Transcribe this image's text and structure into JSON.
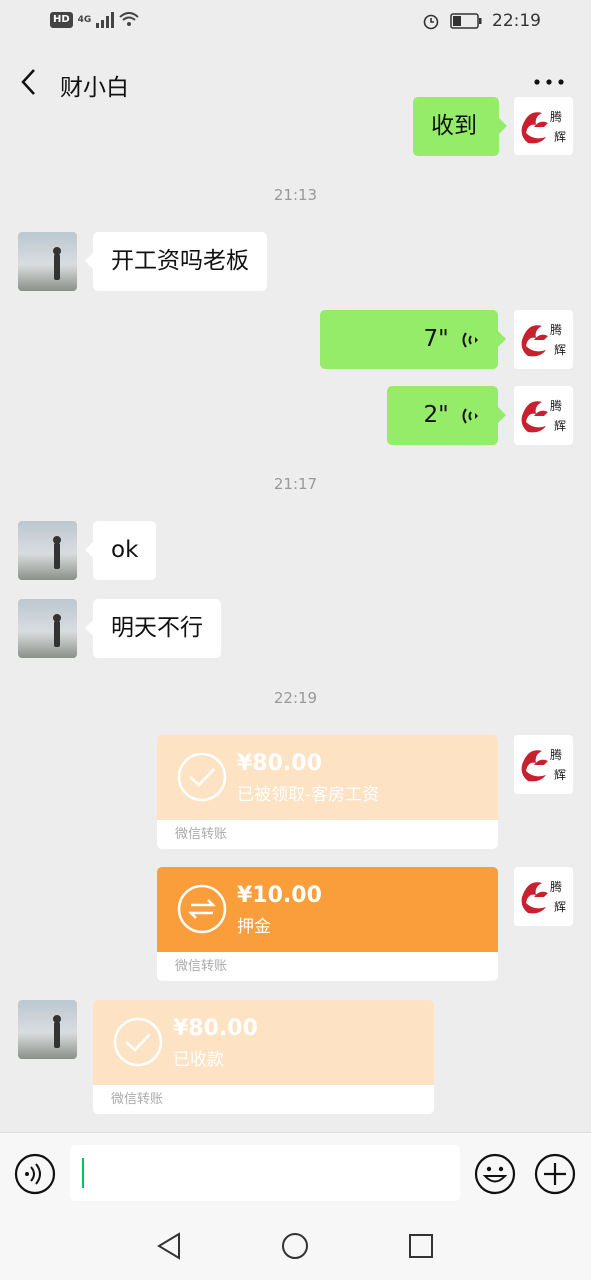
{
  "status": {
    "hd": "HD",
    "net": "4G",
    "time": "22:19"
  },
  "header": {
    "title": "财小白"
  },
  "messages": {
    "m0": "收到",
    "t1": "21:13",
    "m1": "开工资吗老板",
    "v1": "7\"",
    "v2": "2\"",
    "t2": "21:17",
    "m2": "ok",
    "m3": "明天不行",
    "t3": "22:19",
    "tr1": {
      "amount": "¥80.00",
      "desc": "已被领取-客房工资",
      "label": "微信转账"
    },
    "tr2": {
      "amount": "¥10.00",
      "desc": "押金",
      "label": "微信转账"
    },
    "tr3": {
      "amount": "¥80.00",
      "desc": "已收款",
      "label": "微信转账"
    }
  },
  "avatar": {
    "logo_text_1": "腾",
    "logo_text_2": "辉"
  },
  "colors": {
    "sent_bubble": "#95ec69",
    "received_bubble": "#ffffff",
    "transfer_light": "#fde2c3",
    "transfer_orange": "#fa9d3b",
    "background": "#ededed"
  },
  "icons": [
    "back-icon",
    "more-icon",
    "voice-wave-icon",
    "check-icon",
    "transfer-arrows-icon",
    "voice-input-icon",
    "emoji-icon",
    "add-icon",
    "nav-back-icon",
    "nav-home-icon",
    "nav-recent-icon"
  ]
}
